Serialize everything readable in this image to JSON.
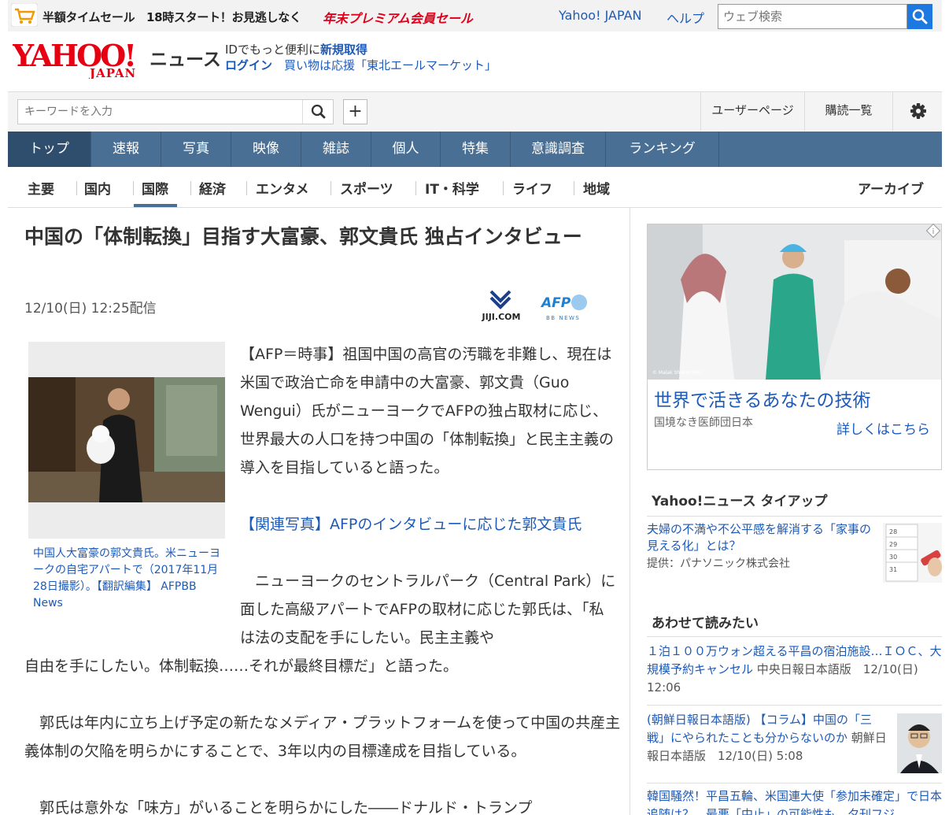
{
  "promo": {
    "text": "半額タイムセール　18時スタート！お見逃しなく",
    "red_text": "年末プレミアム会員セール"
  },
  "header": {
    "yahoo_link": "Yahoo! JAPAN",
    "help_link": "ヘルプ",
    "web_search_placeholder": "ウェブ検索",
    "logo_news": "ニュース",
    "id_prefix": "IDでもっと便利に",
    "id_signup": "新規取得",
    "login": "ログイン",
    "campaign": "買い物は応援「東北エールマーケット」"
  },
  "search": {
    "keyword_placeholder": "キーワードを入力",
    "plus": "+",
    "user_page": "ユーザーページ",
    "subscriptions": "購読一覧"
  },
  "main_tabs": [
    "トップ",
    "速報",
    "写真",
    "映像",
    "雑誌",
    "個人",
    "特集",
    "意識調査",
    "ランキング"
  ],
  "sub_tabs": [
    "主要",
    "国内",
    "国際",
    "経済",
    "エンタメ",
    "スポーツ",
    "IT・科学",
    "ライフ",
    "地域"
  ],
  "archive": "アーカイブ",
  "article": {
    "title": "中国の「体制転換」目指す大富豪、郭文貴氏 独占インタビュー",
    "date": "12/10(日) 12:25配信",
    "jiji_logo_text": "JIJI.COM",
    "afp_logo_text": "AFP",
    "afp_logo_sub": "BB NEWS",
    "caption": "中国人大富豪の郭文貴氏。米ニューヨークの自宅アパートで（2017年11月28日撮影）。【翻訳編集】 AFPBB News",
    "p1": "【AFP＝時事】祖国中国の高官の汚職を非難し、現在は米国で政治亡命を申請中の大富豪、郭文貴（Guo Wengui）氏がニューヨークでAFPの独占取材に応じ、世界最大の人口を持つ中国の「体制転換」と民主主義の導入を目指していると語った。",
    "related": "【関連写真】AFPのインタビューに応じた郭文貴氏",
    "p2a": "　ニューヨークのセントラルパーク（Central Park）に面した高級アパートでAFPの取材に応じた郭氏は、「私は法の支配を手にしたい。民主主義や",
    "p2b": "自由を手にしたい。体制転換……それが最終目標だ」と語った。",
    "p3": "　郭氏は年内に立ち上げ予定の新たなメディア・プラットフォームを使って中国の共産主義体制の欠陥を明らかにすることで、3年以内の目標達成を目指している。",
    "p4": "　郭氏は意外な「味方」がいることを明らかにした――ドナルド・トランプ"
  },
  "sidebar": {
    "ad_title": "世界で活きるあなたの技術",
    "ad_sponsor": "国境なき医師団日本",
    "ad_more": "詳しくはこちら",
    "ad_credit": "© Malak Shaher/MSF",
    "tieup_heading": "Yahoo!ニュース タイアップ",
    "tieup_text": "夫婦の不満や不公平感を解消する「家事の見える化」とは？",
    "tieup_provider": "提供：パナソニック株式会社",
    "tieup_calendar": [
      "28",
      "29",
      "30",
      "31"
    ],
    "related_heading": "あわせて読みたい",
    "related": [
      {
        "title": "１泊１００万ウォン超える平昌の宿泊施設…ＩＯＣ、大規模予約キャンセル",
        "meta": "中央日報日本語版　12/10(日) 12:06"
      },
      {
        "title": "(朝鮮日報日本語版) 【コラム】中国の「三戦」にやられたことも分からないのか",
        "meta": "朝鮮日報日本語版　12/10(日) 5:08"
      },
      {
        "title": "韓国騒然！平昌五輪、米国連大使「参加未確定」で日本追随は？　最悪「中止」の可能性も　夕刊フジ",
        "meta": ""
      }
    ]
  }
}
